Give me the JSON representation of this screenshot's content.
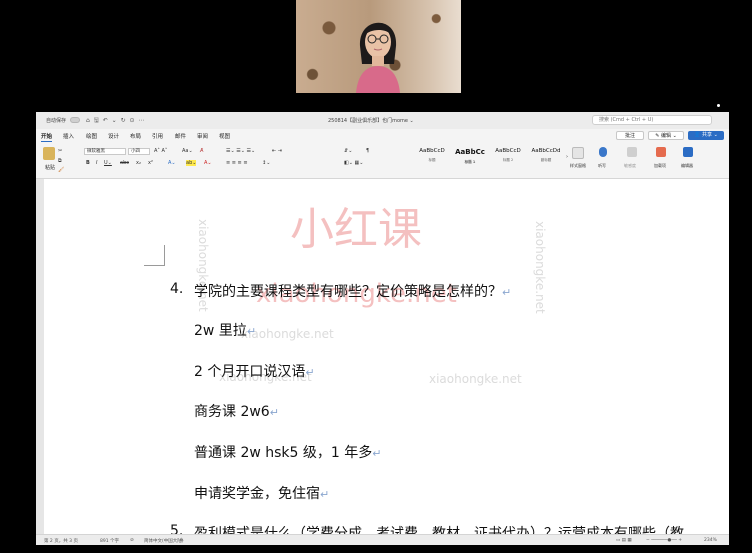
{
  "titlebar": {
    "autosave_label": "自动保存",
    "doc_title": "250814【副业俱乐部】也门mome ⌄",
    "search_placeholder": "搜索 (Cmd + Ctrl + U)"
  },
  "tabs": [
    {
      "label": "开始"
    },
    {
      "label": "插入"
    },
    {
      "label": "绘图"
    },
    {
      "label": "设计"
    },
    {
      "label": "布局"
    },
    {
      "label": "引用"
    },
    {
      "label": "邮件"
    },
    {
      "label": "审阅"
    },
    {
      "label": "视图"
    }
  ],
  "actions": {
    "comment_label": "批注",
    "edit_label": "编辑",
    "share_label": "共享"
  },
  "ribbon": {
    "paste_label": "粘贴",
    "font_name": "微软雅黑",
    "font_size": "小四",
    "styles": [
      {
        "sample": "AaBbCcD",
        "caption": "标题"
      },
      {
        "sample": "AaBbCc",
        "caption": "标题 1"
      },
      {
        "sample": "AaBbCcD",
        "caption": "标题 2"
      },
      {
        "sample": "AaBbCcDd",
        "caption": "副标题"
      }
    ],
    "styles_pane_label": "样式窗格",
    "dictate_label": "听写",
    "sensitivity_label": "敏感度",
    "addins_label": "加载项",
    "editor_label": "编辑器"
  },
  "document": {
    "q4_number": "4.",
    "q4_text": "学院的主要课程类型有哪些？定价策略是怎样的？",
    "lines": [
      "2w 里拉",
      "2 个月开口说汉语",
      "商务课 2w6",
      "普通课 2w hsk5 级，1 年多",
      "申请奖学金，免住宿"
    ],
    "q5_number": "5.",
    "q5_text": "盈利模式是什么（学费分成、考试费、教材、证书代办）？运营成本有哪些（教"
  },
  "watermark": {
    "brand": "小红课",
    "domain": "xiaohongke.net"
  },
  "statusbar": {
    "page": "第 2 页，共 3 页",
    "words": "891 个字",
    "language": "简体中文(中国大陆)",
    "zoom": "234%"
  },
  "colors": {
    "accent": "#2b6cc4",
    "watermark_red": "#eb8c8c"
  }
}
